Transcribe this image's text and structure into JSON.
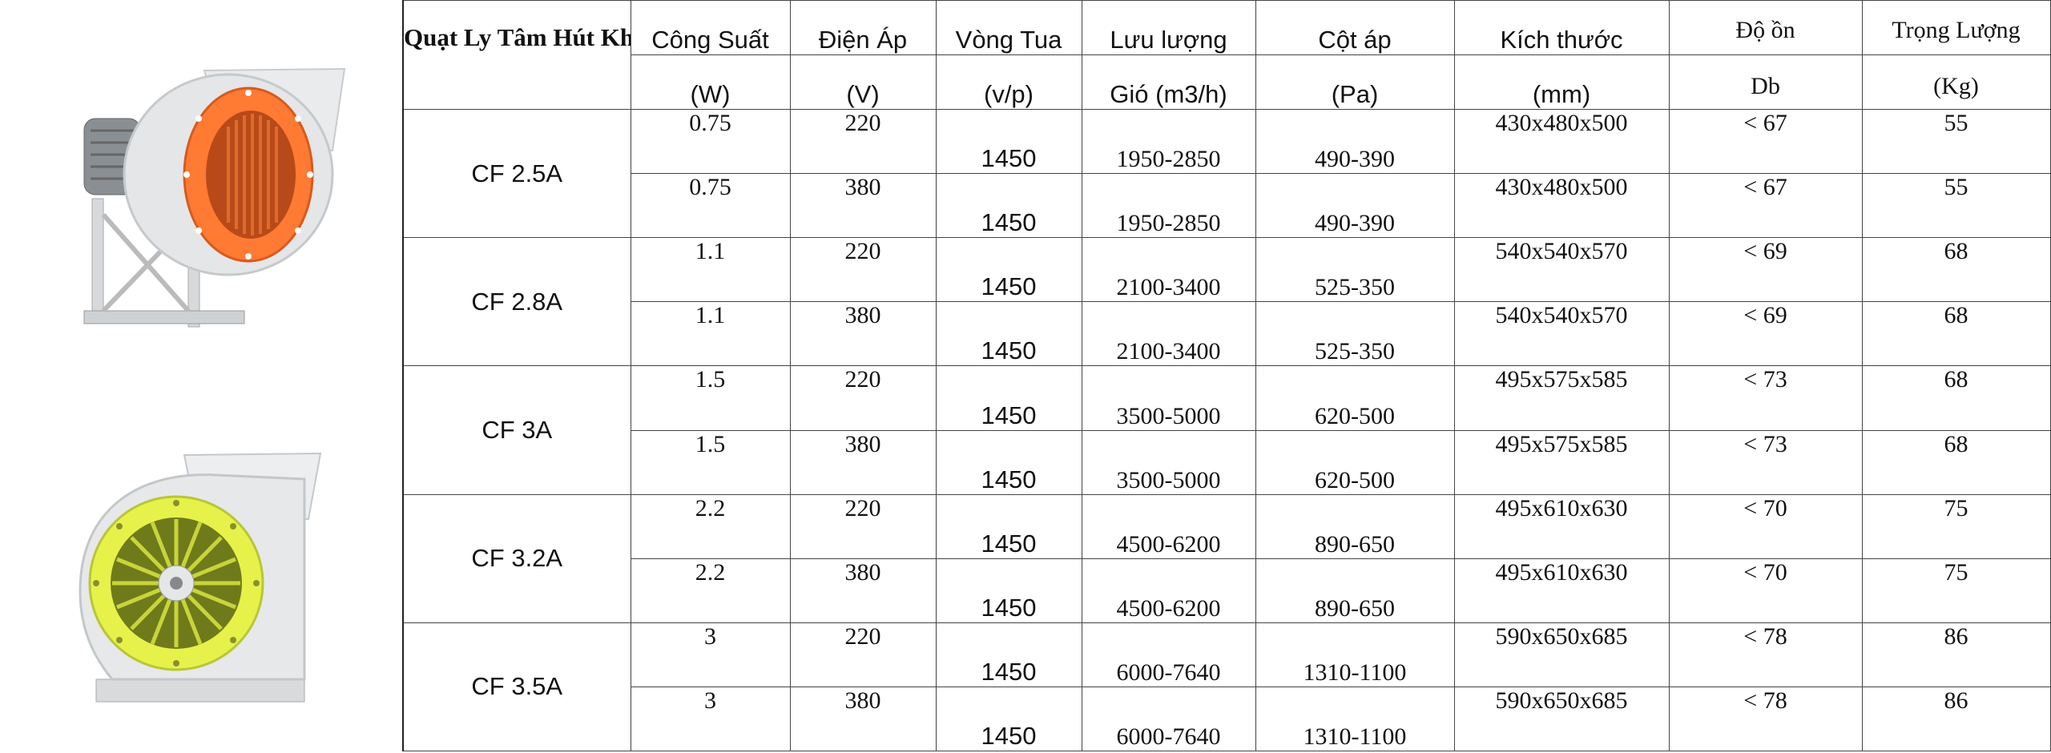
{
  "table": {
    "title": "Quạt Ly Tâm Hút Khói",
    "headers": [
      {
        "top": "Công Suất",
        "bottom": "(W)"
      },
      {
        "top": "Điện Áp",
        "bottom": "(V)"
      },
      {
        "top": "Vòng Tua",
        "bottom": "(v/p)"
      },
      {
        "top": "Lưu lượng",
        "bottom": "Gió (m3/h)"
      },
      {
        "top": "Cột áp",
        "bottom": "(Pa)"
      },
      {
        "top": "Kích thước",
        "bottom": "(mm)"
      },
      {
        "top": "Độ ồn",
        "bottom": "Db"
      },
      {
        "top": "Trọng Lượng",
        "bottom": "(Kg)"
      }
    ],
    "groups": [
      {
        "model": "CF 2.5A",
        "rows": [
          [
            "0.75",
            "220",
            "1450",
            "1950-2850",
            "490-390",
            "430x480x500",
            "< 67",
            "55"
          ],
          [
            "0.75",
            "380",
            "1450",
            "1950-2850",
            "490-390",
            "430x480x500",
            "< 67",
            "55"
          ]
        ]
      },
      {
        "model": "CF 2.8A",
        "rows": [
          [
            "1.1",
            "220",
            "1450",
            "2100-3400",
            "525-350",
            "540x540x570",
            "< 69",
            "68"
          ],
          [
            "1.1",
            "380",
            "1450",
            "2100-3400",
            "525-350",
            "540x540x570",
            "< 69",
            "68"
          ]
        ]
      },
      {
        "model": "CF 3A",
        "rows": [
          [
            "1.5",
            "220",
            "1450",
            "3500-5000",
            "620-500",
            "495x575x585",
            "< 73",
            "68"
          ],
          [
            "1.5",
            "380",
            "1450",
            "3500-5000",
            "620-500",
            "495x575x585",
            "< 73",
            "68"
          ]
        ]
      },
      {
        "model": "CF 3.2A",
        "rows": [
          [
            "2.2",
            "220",
            "1450",
            "4500-6200",
            "890-650",
            "495x610x630",
            "< 70",
            "75"
          ],
          [
            "2.2",
            "380",
            "1450",
            "4500-6200",
            "890-650",
            "495x610x630",
            "< 70",
            "75"
          ]
        ]
      },
      {
        "model": "CF 3.5A",
        "rows": [
          [
            "3",
            "220",
            "1450",
            "6000-7640",
            "1310-1100",
            "590x650x685",
            "< 78",
            "86"
          ],
          [
            "3",
            "380",
            "1450",
            "6000-7640",
            "1310-1100",
            "590x650x685",
            "< 78",
            "86"
          ]
        ]
      }
    ]
  },
  "images": {
    "top_icon": "centrifugal-fan-orange-icon",
    "bottom_icon": "centrifugal-fan-yellow-icon",
    "colors": {
      "orange": "#ff7a33",
      "yellow": "#e6f24a",
      "body": "#e4e6e8",
      "text_title": "#1f1fa8"
    }
  }
}
